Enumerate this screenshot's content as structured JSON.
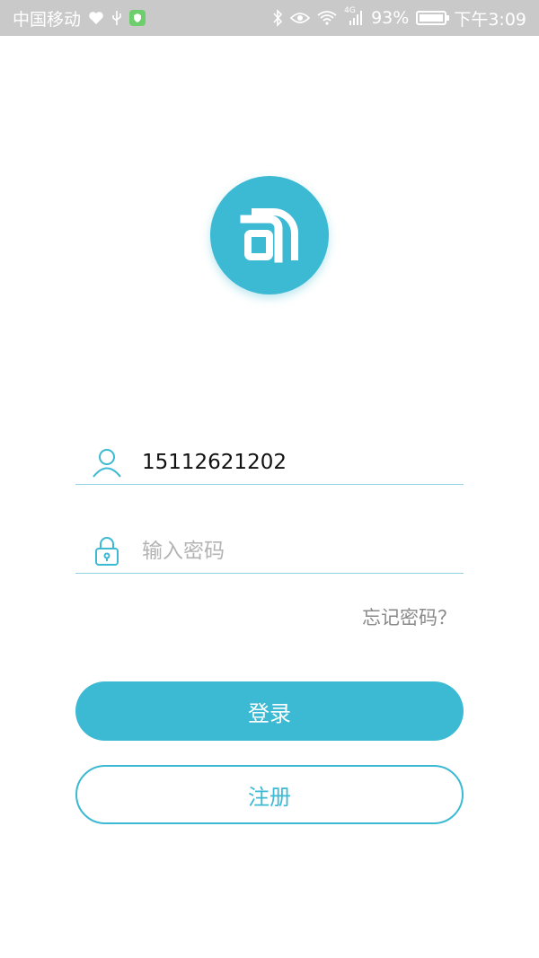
{
  "status_bar": {
    "carrier": "中国移动",
    "battery": "93%",
    "network": "4G",
    "time": "下午3:09"
  },
  "login": {
    "phone_value": "15112621202",
    "password_placeholder": "输入密码",
    "forgot_label": "忘记密码？",
    "login_label": "登录",
    "register_label": "注册"
  },
  "colors": {
    "accent": "#3cb9d3",
    "status_bar_bg": "#c9c9c9"
  }
}
